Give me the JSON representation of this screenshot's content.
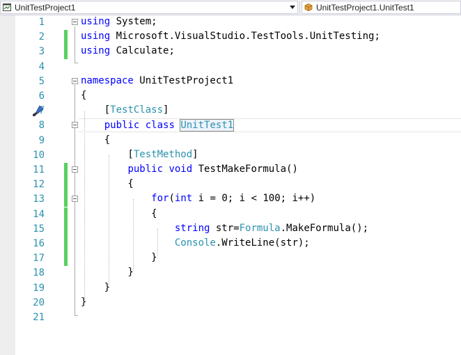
{
  "navbar": {
    "project_dropdown": "UnitTestProject1",
    "member_dropdown": "UnitTestProject1.UnitTest1"
  },
  "editor": {
    "lines": [
      {
        "n": "1",
        "tokens": [
          {
            "t": "using",
            "c": "kw"
          },
          {
            "t": " System;"
          }
        ]
      },
      {
        "n": "2",
        "tokens": [
          {
            "t": "using",
            "c": "kw"
          },
          {
            "t": " Microsoft.VisualStudio.TestTools.UnitTesting;"
          }
        ]
      },
      {
        "n": "3",
        "tokens": [
          {
            "t": "using",
            "c": "kw"
          },
          {
            "t": " Calculate;"
          }
        ]
      },
      {
        "n": "4",
        "tokens": []
      },
      {
        "n": "5",
        "tokens": [
          {
            "t": "namespace",
            "c": "kw"
          },
          {
            "t": " UnitTestProject1"
          }
        ]
      },
      {
        "n": "6",
        "tokens": [
          {
            "t": "{"
          }
        ]
      },
      {
        "n": "7",
        "tokens": [
          {
            "t": "    ["
          },
          {
            "t": "TestClass",
            "c": "ty"
          },
          {
            "t": "]"
          }
        ]
      },
      {
        "n": "8",
        "tokens": [
          {
            "t": "    "
          },
          {
            "t": "public",
            "c": "kw"
          },
          {
            "t": " "
          },
          {
            "t": "class",
            "c": "kw"
          },
          {
            "t": " "
          },
          {
            "t": "UnitTest1",
            "c": "ty sel"
          }
        ]
      },
      {
        "n": "9",
        "tokens": [
          {
            "t": "    {"
          }
        ]
      },
      {
        "n": "10",
        "tokens": [
          {
            "t": "        ["
          },
          {
            "t": "TestMethod",
            "c": "ty"
          },
          {
            "t": "]"
          }
        ]
      },
      {
        "n": "11",
        "tokens": [
          {
            "t": "        "
          },
          {
            "t": "public",
            "c": "kw"
          },
          {
            "t": " "
          },
          {
            "t": "void",
            "c": "kw"
          },
          {
            "t": " TestMakeFormula()"
          }
        ]
      },
      {
        "n": "12",
        "tokens": [
          {
            "t": "        {"
          }
        ]
      },
      {
        "n": "13",
        "tokens": [
          {
            "t": "            "
          },
          {
            "t": "for",
            "c": "kw"
          },
          {
            "t": "("
          },
          {
            "t": "int",
            "c": "kw"
          },
          {
            "t": " i = 0; i < 100; i++)"
          }
        ]
      },
      {
        "n": "14",
        "tokens": [
          {
            "t": "            {"
          }
        ]
      },
      {
        "n": "15",
        "tokens": [
          {
            "t": "                "
          },
          {
            "t": "string",
            "c": "kw"
          },
          {
            "t": " str="
          },
          {
            "t": "Formula",
            "c": "ty"
          },
          {
            "t": ".MakeFormula();"
          }
        ]
      },
      {
        "n": "16",
        "tokens": [
          {
            "t": "                "
          },
          {
            "t": "Console",
            "c": "ty"
          },
          {
            "t": ".WriteLine(str);"
          }
        ]
      },
      {
        "n": "17",
        "tokens": [
          {
            "t": "            }"
          }
        ]
      },
      {
        "n": "18",
        "tokens": [
          {
            "t": "        }"
          }
        ]
      },
      {
        "n": "19",
        "tokens": [
          {
            "t": "    }"
          }
        ]
      },
      {
        "n": "20",
        "tokens": [
          {
            "t": "}"
          }
        ]
      },
      {
        "n": "21",
        "tokens": []
      }
    ]
  },
  "colors": {
    "keyword": "#0000ff",
    "type": "#2b91af",
    "line_number": "#2b91af",
    "changed_bar": "#57d15d"
  }
}
